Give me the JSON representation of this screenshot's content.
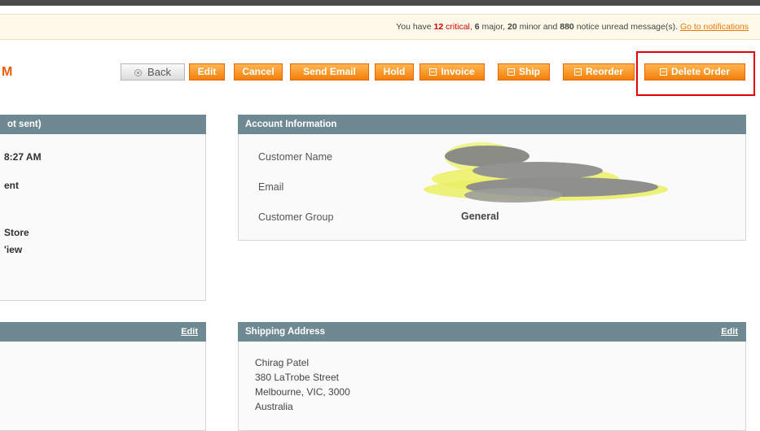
{
  "notifications": {
    "prefix": "You have ",
    "critical_count": "12",
    "critical_label": "critical",
    "major_count": "6",
    "major_label": "major,",
    "minor_count": "20",
    "minor_label": "minor and",
    "notice_count": "880",
    "suffix": "notice unread message(s).",
    "link": "Go to notifications"
  },
  "page": {
    "title_fragment": "M"
  },
  "toolbar": {
    "back": "Back",
    "edit": "Edit",
    "cancel": "Cancel",
    "send_email": "Send Email",
    "hold": "Hold",
    "invoice": "Invoice",
    "ship": "Ship",
    "reorder": "Reorder",
    "delete_order": "Delete Order"
  },
  "order_box": {
    "title_fragment": "ot sent)",
    "line1": "8:27 AM",
    "line2": "ent",
    "line3": "Store",
    "line4": "'iew"
  },
  "account_info": {
    "title": "Account Information",
    "customer_name_label": "Customer Name",
    "email_label": "Email",
    "customer_group_label": "Customer Group",
    "customer_group_value": "General"
  },
  "billing_box": {
    "edit_link": "Edit"
  },
  "shipping_address": {
    "title": "Shipping Address",
    "edit_link": "Edit",
    "lines": [
      "Chirag Patel",
      "380 LaTrobe Street",
      "Melbourne, VIC, 3000",
      "Australia"
    ]
  },
  "colors": {
    "button_orange": "#f3800a",
    "box_header": "#6f8992",
    "title_orange": "#eb5e00",
    "highlight_red": "#e30000",
    "critical_red": "#d40000"
  }
}
